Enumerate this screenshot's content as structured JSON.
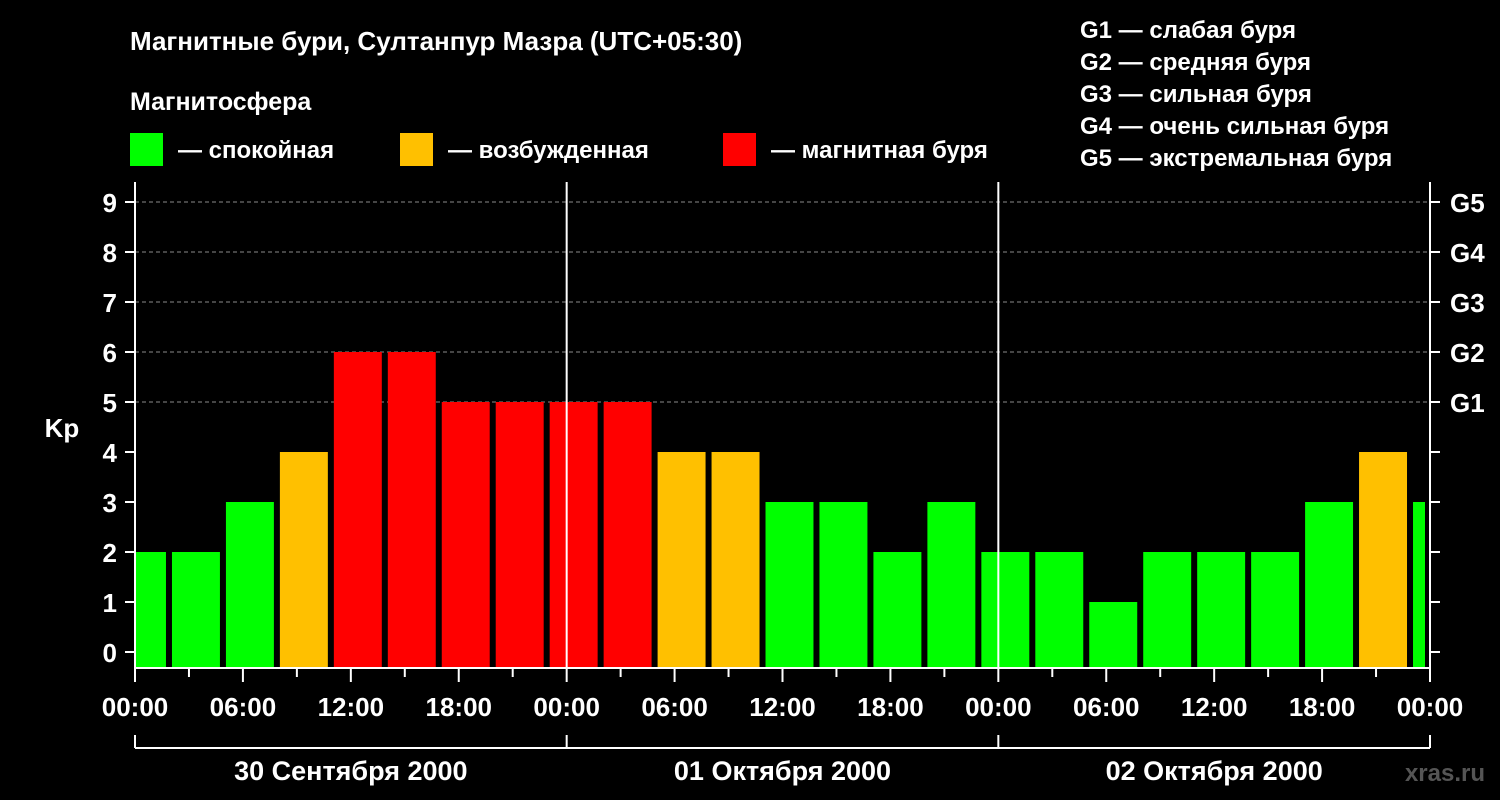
{
  "chart_data": {
    "type": "bar",
    "title": "Магнитные бури, Султанпур Мазра (UTC+05:30)",
    "legend_title": "Магнитосфера",
    "legend": [
      {
        "label": "— спокойная",
        "color": "#00ff00"
      },
      {
        "label": "— возбужденная",
        "color": "#ffc000"
      },
      {
        "label": "— магнитная буря",
        "color": "#ff0000"
      }
    ],
    "storm_scale": [
      "G1 — слабая буря",
      "G2 — средняя буря",
      "G3 — сильная буря",
      "G4 — очень сильная буря",
      "G5 — экстремальная буря"
    ],
    "ylabel": "Kp",
    "ylim": [
      0,
      9
    ],
    "y_ticks": [
      "0",
      "1",
      "2",
      "3",
      "4",
      "5",
      "6",
      "7",
      "8",
      "9"
    ],
    "right_ticks": [
      {
        "label": "G1",
        "value": 5
      },
      {
        "label": "G2",
        "value": 6
      },
      {
        "label": "G3",
        "value": 7
      },
      {
        "label": "G4",
        "value": 8
      },
      {
        "label": "G5",
        "value": 9
      }
    ],
    "grid": "dashed horizontal at Kp 5–9",
    "x_tick_labels": [
      "00:00",
      "06:00",
      "12:00",
      "18:00",
      "00:00",
      "06:00",
      "12:00",
      "18:00",
      "00:00",
      "06:00",
      "12:00",
      "18:00",
      "00:00"
    ],
    "x_range_hours": [
      0,
      72
    ],
    "day_separators_hours": [
      24,
      48
    ],
    "days": [
      "30 Сентября 2000",
      "01 Октября 2000",
      "02 Октября 2000"
    ],
    "bars": [
      {
        "start": 0,
        "end": 2,
        "value": 2,
        "color": "#00ff00"
      },
      {
        "start": 2,
        "end": 5,
        "value": 2,
        "color": "#00ff00"
      },
      {
        "start": 5,
        "end": 8,
        "value": 3,
        "color": "#00ff00"
      },
      {
        "start": 8,
        "end": 11,
        "value": 4,
        "color": "#ffc000"
      },
      {
        "start": 11,
        "end": 14,
        "value": 6,
        "color": "#ff0000"
      },
      {
        "start": 14,
        "end": 17,
        "value": 6,
        "color": "#ff0000"
      },
      {
        "start": 17,
        "end": 20,
        "value": 5,
        "color": "#ff0000"
      },
      {
        "start": 20,
        "end": 23,
        "value": 5,
        "color": "#ff0000"
      },
      {
        "start": 23,
        "end": 26,
        "value": 5,
        "color": "#ff0000"
      },
      {
        "start": 26,
        "end": 29,
        "value": 5,
        "color": "#ff0000"
      },
      {
        "start": 29,
        "end": 32,
        "value": 4,
        "color": "#ffc000"
      },
      {
        "start": 32,
        "end": 35,
        "value": 4,
        "color": "#ffc000"
      },
      {
        "start": 35,
        "end": 38,
        "value": 3,
        "color": "#00ff00"
      },
      {
        "start": 38,
        "end": 41,
        "value": 3,
        "color": "#00ff00"
      },
      {
        "start": 41,
        "end": 44,
        "value": 2,
        "color": "#00ff00"
      },
      {
        "start": 44,
        "end": 47,
        "value": 3,
        "color": "#00ff00"
      },
      {
        "start": 47,
        "end": 50,
        "value": 2,
        "color": "#00ff00"
      },
      {
        "start": 50,
        "end": 53,
        "value": 2,
        "color": "#00ff00"
      },
      {
        "start": 53,
        "end": 56,
        "value": 1,
        "color": "#00ff00"
      },
      {
        "start": 56,
        "end": 59,
        "value": 2,
        "color": "#00ff00"
      },
      {
        "start": 59,
        "end": 62,
        "value": 2,
        "color": "#00ff00"
      },
      {
        "start": 62,
        "end": 65,
        "value": 2,
        "color": "#00ff00"
      },
      {
        "start": 65,
        "end": 68,
        "value": 3,
        "color": "#00ff00"
      },
      {
        "start": 68,
        "end": 71,
        "value": 4,
        "color": "#ffc000"
      },
      {
        "start": 71,
        "end": 72,
        "value": 3,
        "color": "#00ff00"
      }
    ]
  },
  "watermark": "xras.ru"
}
